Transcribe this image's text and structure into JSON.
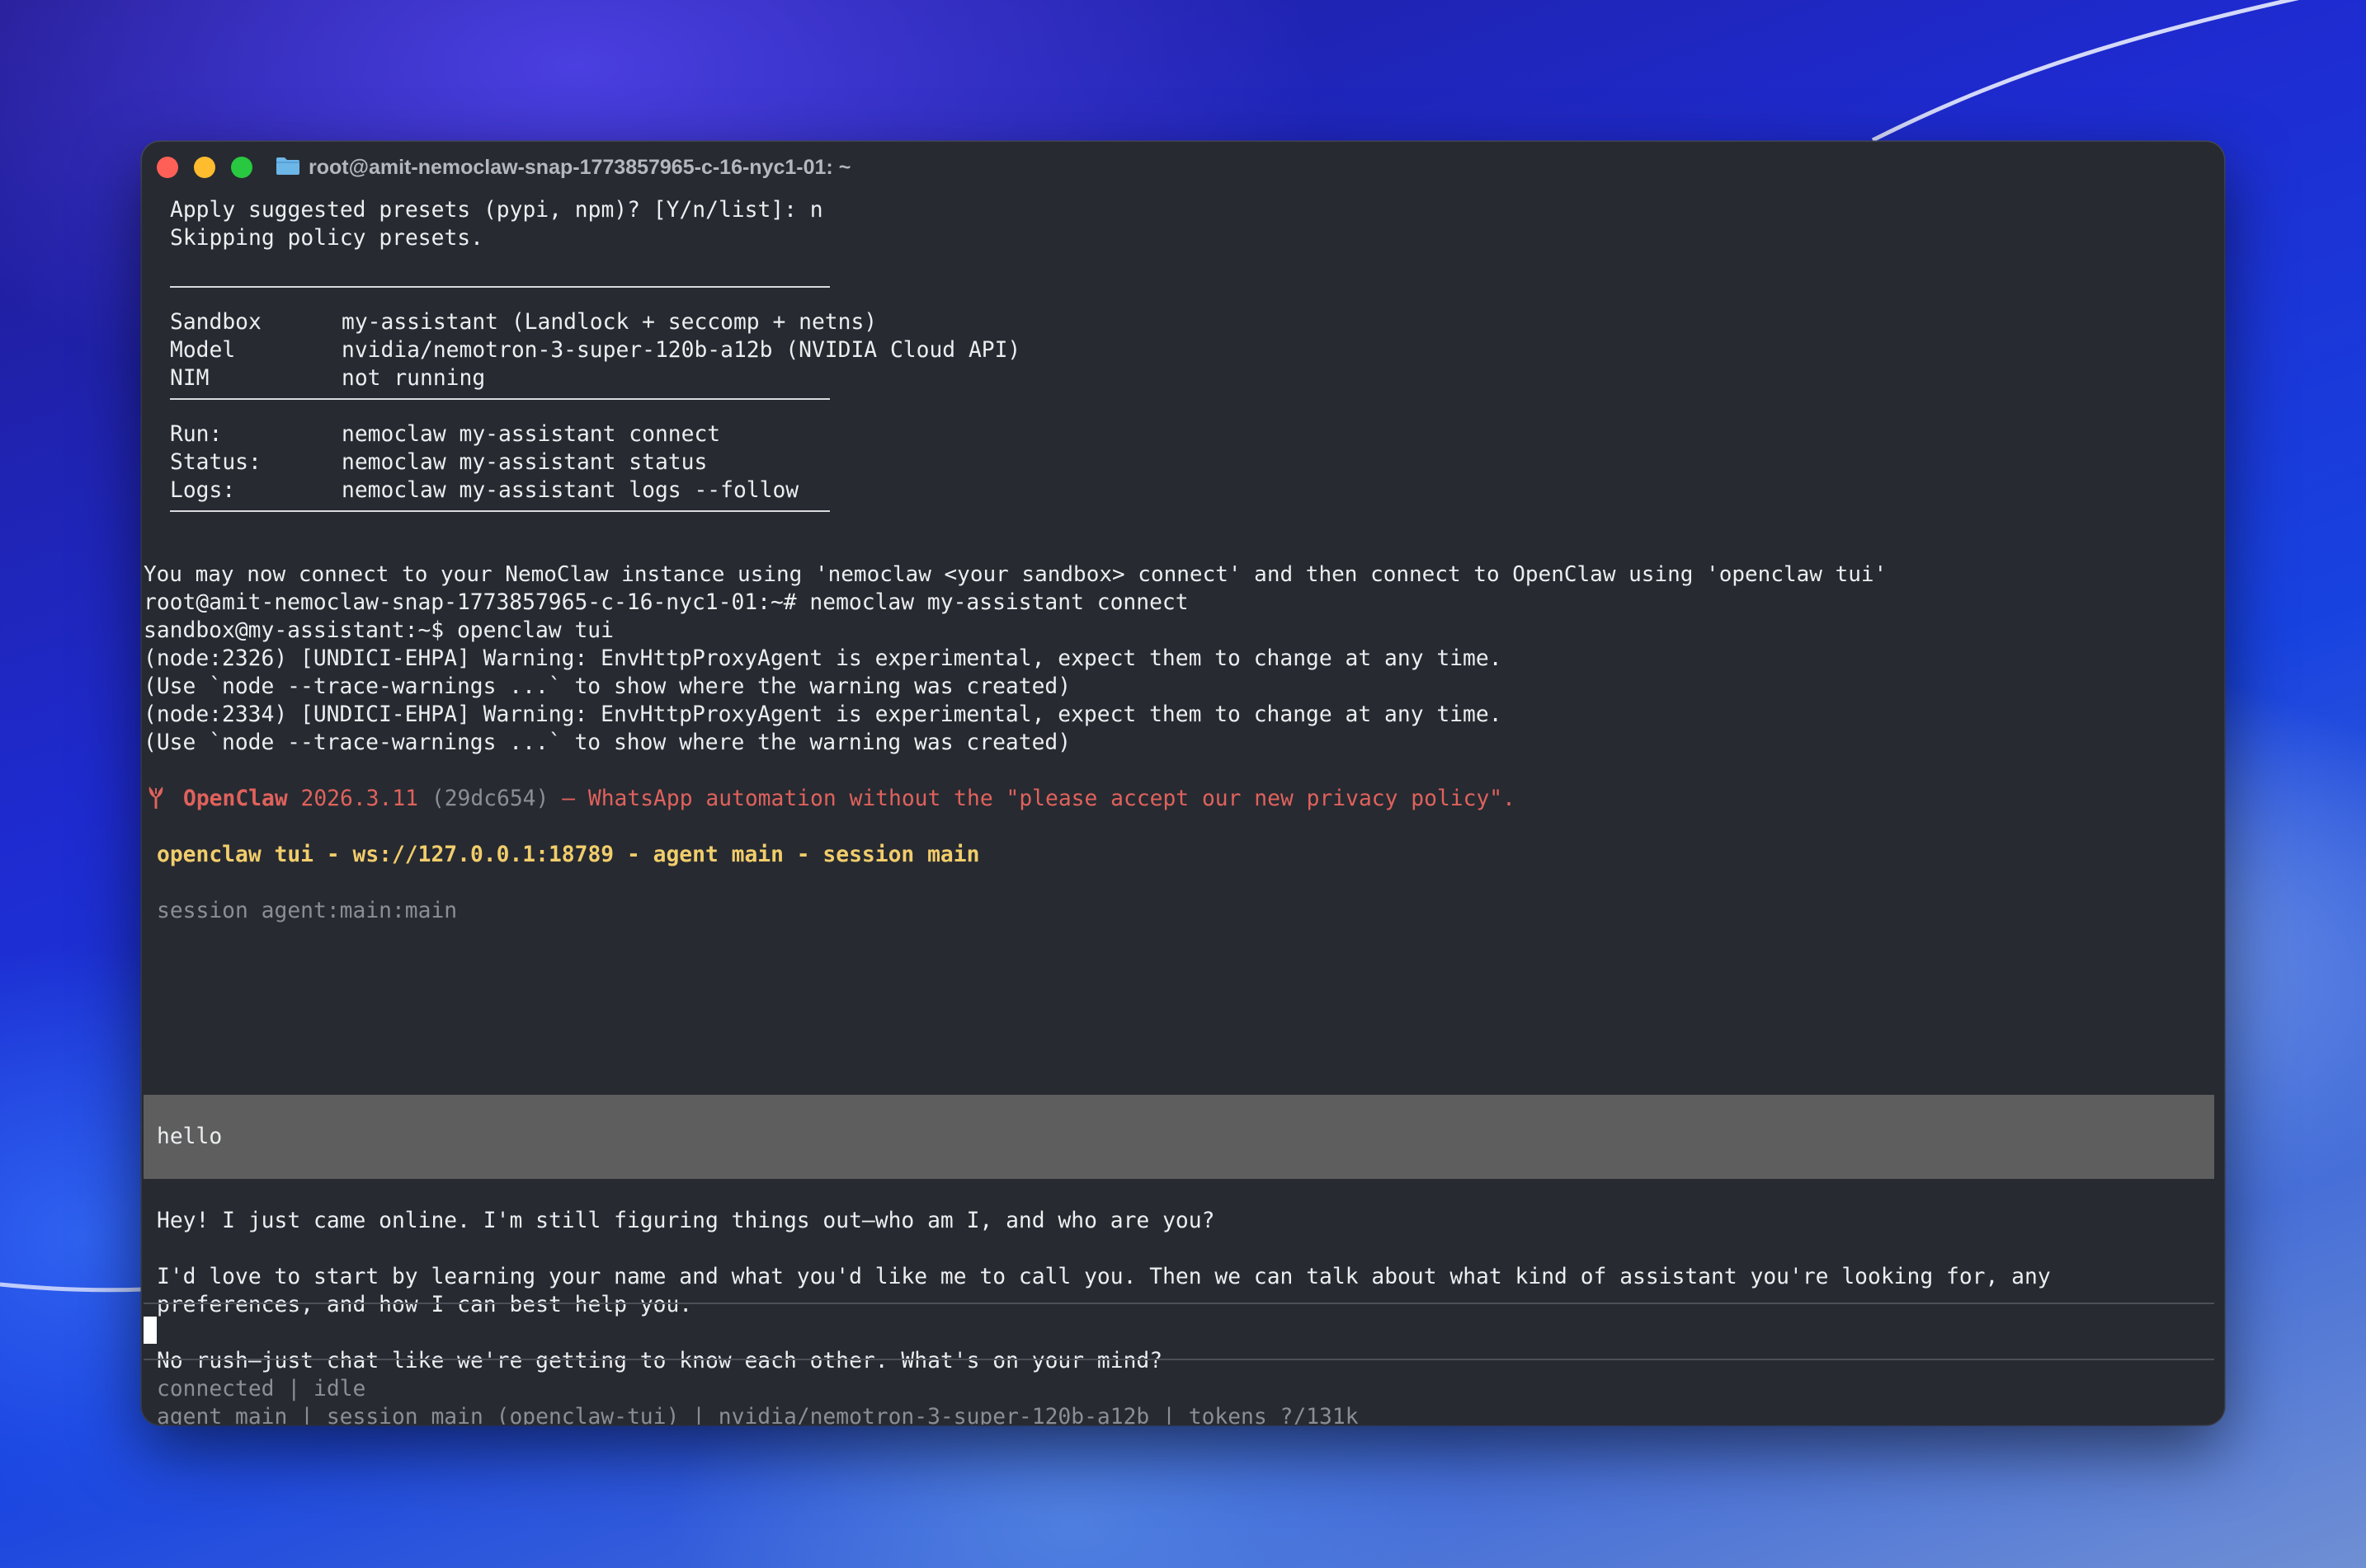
{
  "window": {
    "title": "root@amit-nemoclaw-snap-1773857965-c-16-nyc1-01: ~",
    "folder_icon": "folder-icon",
    "controls": [
      "close-button",
      "minimize-button",
      "maximize-button"
    ]
  },
  "terminal": {
    "preset_prompt": "Apply suggested presets (pypi, npm)? [Y/n/list]: n",
    "skipping": "Skipping policy presets.",
    "summary": [
      {
        "key": "Sandbox",
        "value": "my-assistant (Landlock + seccomp + netns)"
      },
      {
        "key": "Model",
        "value": "nvidia/nemotron-3-super-120b-a12b (NVIDIA Cloud API)"
      },
      {
        "key": "NIM",
        "value": "not running"
      }
    ],
    "commands": [
      {
        "key": "Run:",
        "value": "nemoclaw my-assistant connect"
      },
      {
        "key": "Status:",
        "value": "nemoclaw my-assistant status"
      },
      {
        "key": "Logs:",
        "value": "nemoclaw my-assistant logs --follow"
      }
    ],
    "connect_hint": "You may now connect to your NemoClaw instance using 'nemoclaw <your sandbox> connect' and then connect to OpenClaw using 'openclaw tui'",
    "shell_cmd": "root@amit-nemoclaw-snap-1773857965-c-16-nyc1-01:~# nemoclaw my-assistant connect",
    "sandbox_cmd": "sandbox@my-assistant:~$ openclaw tui",
    "warnings": [
      "(node:2326) [UNDICI-EHPA] Warning: EnvHttpProxyAgent is experimental, expect them to change at any time.",
      "(Use `node --trace-warnings ...` to show where the warning was created)",
      "(node:2334) [UNDICI-EHPA] Warning: EnvHttpProxyAgent is experimental, expect them to change at any time.",
      "(Use `node --trace-warnings ...` to show where the warning was created)"
    ]
  },
  "openclaw": {
    "logo_icon": "lobster-icon",
    "brand": "OpenClaw",
    "version": "2026.3.11",
    "commit": "(29dc654)",
    "tagline": "— WhatsApp automation without the \"please accept our new privacy policy\".",
    "header": "openclaw tui - ws://127.0.0.1:18789 - agent main - session main",
    "session": "session agent:main:main",
    "user_message": "hello",
    "reply": [
      "Hey! I just came online. I'm still figuring things out—who am I, and who are you?",
      "I'd love to start by learning your name and what you'd like me to call you. Then we can talk about what kind of assistant you're looking for, any",
      "preferences, and how I can best help you.",
      "No rush—just chat like we're getting to know each other. What's on your mind?"
    ],
    "status": "connected | idle",
    "footer": "agent main | session main (openclaw-tui) | nvidia/nemotron-3-super-120b-a12b | tokens ?/131k",
    "input_value": ""
  },
  "colors": {
    "terminal_bg": "#272a31",
    "brand_red": "#e0625c",
    "header_gold": "#f1cd6b",
    "message_bg": "#5e5e5e",
    "dim_text": "#8a8e95"
  }
}
